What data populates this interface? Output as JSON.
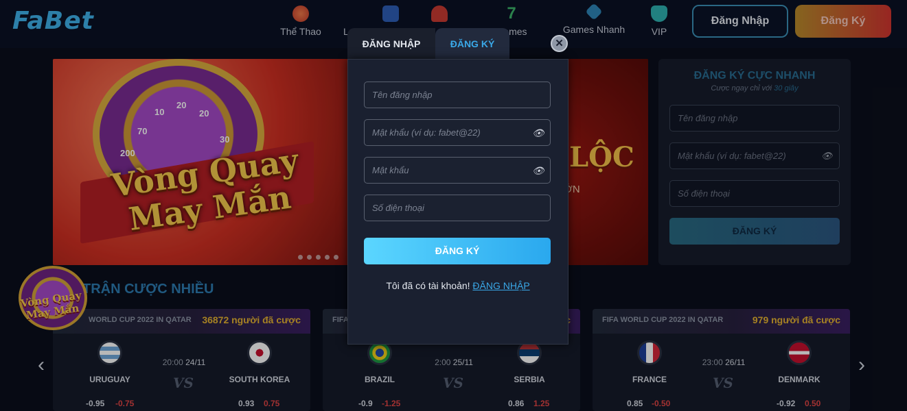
{
  "header": {
    "logo_text": "FaBet",
    "nav": [
      {
        "label": "Thể Thao",
        "icon": "soccer-ball-icon",
        "color": "#d84b3a"
      },
      {
        "label": "L",
        "icon": "trophy-icon",
        "color": "#3a6ed8"
      },
      {
        "label": "",
        "icon": "spade-card-icon",
        "color": "#d84b3a"
      },
      {
        "label": "Games",
        "icon": "number-seven-icon",
        "color": "#3cb56a"
      },
      {
        "label": "Games Nhanh",
        "icon": "cube-icon",
        "color": "#2e86b8"
      },
      {
        "label": "VIP",
        "icon": "vip-cup-icon",
        "color": "#3ac4c4"
      }
    ],
    "login_button": "Đăng Nhập",
    "register_button": "Đăng Ký"
  },
  "banner": {
    "wheel_numbers": [
      "10",
      "20",
      "20",
      "30",
      "70",
      "200"
    ],
    "title_line1": "Vòng Quay",
    "title_line2": "May Mắn",
    "right_title": "LỘC",
    "right_sub": "ỚN"
  },
  "quick_register": {
    "title": "ĐĂNG KÝ CỰC NHANH",
    "subtitle_prefix": "Cược ngay chỉ với",
    "subtitle_highlight": "30 giây",
    "username_placeholder": "Tên đăng nhập",
    "password_placeholder": "Mật khẩu (ví dụ: fabet@22)",
    "phone_placeholder": "Số điện thoại",
    "submit": "ĐĂNG KÝ"
  },
  "matches_section": {
    "title": "TRẬN CƯỢC NHIỀU",
    "floating_promo_line1": "Vòng Quay",
    "floating_promo_line2": "May Mắn",
    "cards": [
      {
        "league": "WORLD CUP 2022 IN QATAR",
        "bettors": "36872 người đã cược",
        "home": "URUGUAY",
        "away": "SOUTH KOREA",
        "time": "20:00",
        "date": "24/11",
        "odd1": "-0.95",
        "odd2": "-0.75",
        "odd3": "0.93",
        "odd4": "0.75"
      },
      {
        "league": "FIFA",
        "bettors": "c",
        "home": "BRAZIL",
        "away": "SERBIA",
        "time": "2:00",
        "date": "25/11",
        "odd1": "-0.9",
        "odd2": "-1.25",
        "odd3": "0.86",
        "odd4": "1.25"
      },
      {
        "league": "FIFA WORLD CUP 2022 IN QATAR",
        "bettors": "979 người đã cược",
        "home": "FRANCE",
        "away": "DENMARK",
        "time": "23:00",
        "date": "26/11",
        "odd1": "0.85",
        "odd2": "-0.50",
        "odd3": "-0.92",
        "odd4": "0.50"
      }
    ],
    "vs_label": "VS"
  },
  "modal": {
    "tab_login": "ĐĂNG NHẬP",
    "tab_register": "ĐĂNG KÝ",
    "close": "✕",
    "username_placeholder": "Tên đăng nhập",
    "password_placeholder": "Mật khẩu (ví dụ: fabet@22)",
    "confirm_placeholder": "Mật khẩu",
    "phone_placeholder": "Số điện thoại",
    "submit": "ĐĂNG KÝ",
    "footer_text": "Tôi đã có tài khoản!",
    "footer_link": "ĐĂNG NHẬP"
  }
}
